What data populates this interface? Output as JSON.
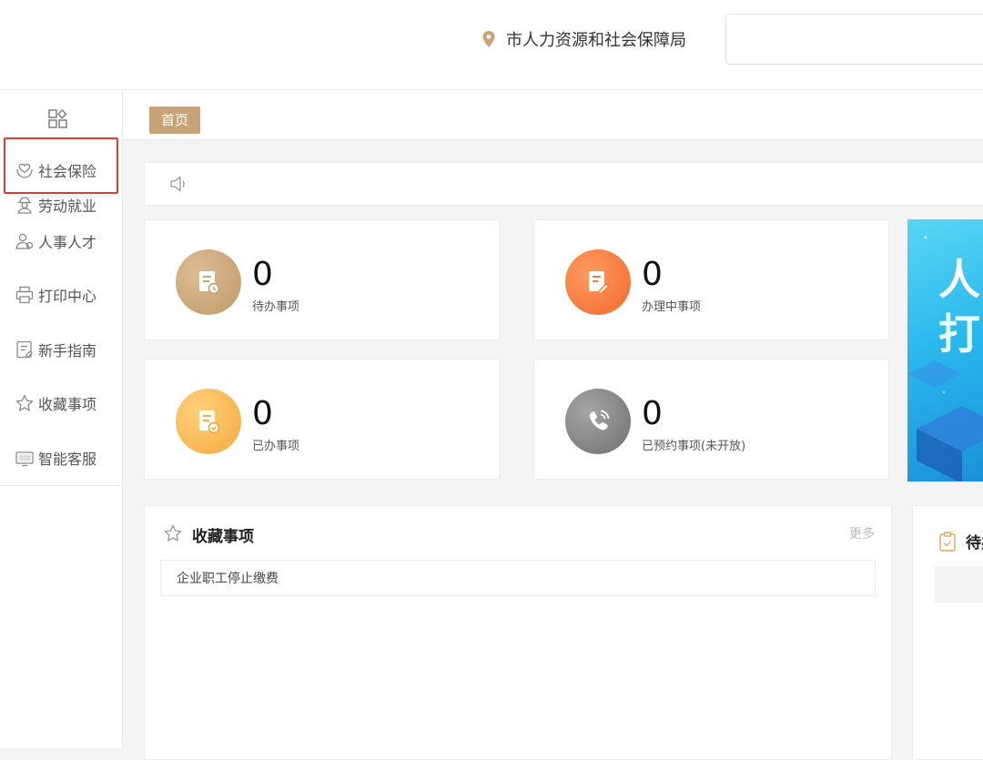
{
  "header": {
    "location_text": "市人力资源和社会保障局",
    "search_value": ""
  },
  "sidebar": {
    "items": [
      {
        "label": "社会保险",
        "icon": "hands-heart-icon"
      },
      {
        "label": "劳动就业",
        "icon": "worker-icon"
      },
      {
        "label": "人事人才",
        "icon": "people-icon"
      },
      {
        "label": "打印中心",
        "icon": "printer-icon"
      },
      {
        "label": "新手指南",
        "icon": "guide-icon"
      },
      {
        "label": "收藏事项",
        "icon": "star-icon"
      },
      {
        "label": "智能客服",
        "icon": "customer-service-icon"
      }
    ],
    "highlighted_item": "社会保险"
  },
  "tabs": [
    {
      "label": "首页",
      "active": true
    }
  ],
  "stats": [
    {
      "count": "0",
      "label": "待办事项",
      "color": "#c9a273"
    },
    {
      "count": "0",
      "label": "办理中事项",
      "color": "#f57c3c"
    },
    {
      "count": "0",
      "label": "已办事项",
      "color": "#f7b64e"
    },
    {
      "count": "0",
      "label": "已预约事项(未开放)",
      "color": "#8a8a8a"
    }
  ],
  "banner": {
    "line1": "人",
    "line2": "打"
  },
  "favorites": {
    "title": "收藏事项",
    "more_label": "更多",
    "items": [
      "企业职工停止缴费"
    ]
  },
  "todo": {
    "title": "待办"
  },
  "colors": {
    "accent": "#c7a377",
    "highlight": "#e53935"
  }
}
